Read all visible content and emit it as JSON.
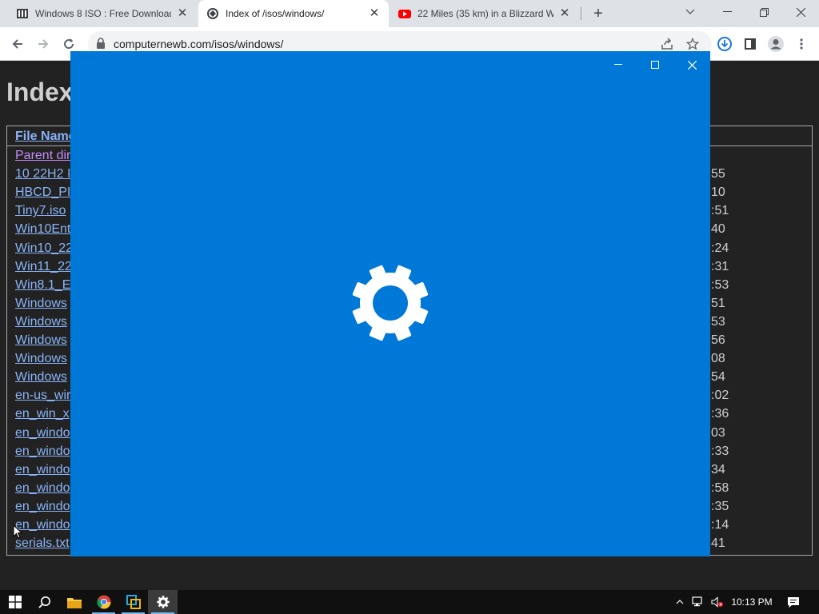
{
  "browser": {
    "tabs": [
      {
        "title": "Windows 8 ISO : Free Download,",
        "icon": "archive-icon",
        "active": false
      },
      {
        "title": "Index of /isos/windows/",
        "icon": "site-icon",
        "active": true
      },
      {
        "title": "22 Miles (35 km) in a Blizzard Wi",
        "icon": "youtube-icon",
        "active": false
      }
    ],
    "new_tab_label": "+",
    "url": "computernewb.com/isos/windows/"
  },
  "page": {
    "heading": "Index",
    "column_header": "File Name",
    "rows": [
      {
        "name": "Parent dir",
        "time": "",
        "visited": true
      },
      {
        "name": "10 22H2 I",
        "time": "55"
      },
      {
        "name": "HBCD_PI",
        "time": "10"
      },
      {
        "name": "Tiny7.iso",
        "time": ":51"
      },
      {
        "name": "Win10Ent",
        "time": "40"
      },
      {
        "name": "Win10_22",
        "time": ":24"
      },
      {
        "name": "Win11_22",
        "time": ":31"
      },
      {
        "name": "Win8.1_E",
        "time": ":53"
      },
      {
        "name": "Windows ",
        "time": "51"
      },
      {
        "name": "Windows ",
        "time": "53"
      },
      {
        "name": "Windows ",
        "time": "56"
      },
      {
        "name": "Windows ",
        "time": "08"
      },
      {
        "name": "Windows ",
        "time": "54"
      },
      {
        "name": "en-us_wir",
        "time": ":02"
      },
      {
        "name": "en_win_x",
        "time": ":36"
      },
      {
        "name": "en_windo",
        "time": "03"
      },
      {
        "name": "en_windo",
        "time": ":33"
      },
      {
        "name": "en_windo",
        "time": "34"
      },
      {
        "name": "en_windo",
        "time": ":58"
      },
      {
        "name": "en_windo",
        "time": ":35"
      },
      {
        "name": "en_windo",
        "time": ":14"
      },
      {
        "name": "serials.txt",
        "time": "41"
      }
    ]
  },
  "splash": {
    "icon": "gear-icon",
    "background": "#0078d7"
  },
  "taskbar": {
    "clock": "10:13 PM",
    "apps": [
      "start-icon",
      "search-icon",
      "file-explorer-icon",
      "chrome-icon",
      "vm-icon",
      "settings-icon"
    ]
  },
  "colors": {
    "link": "#8ab4f8",
    "visited": "#c58af9",
    "accent": "#0078d7"
  }
}
